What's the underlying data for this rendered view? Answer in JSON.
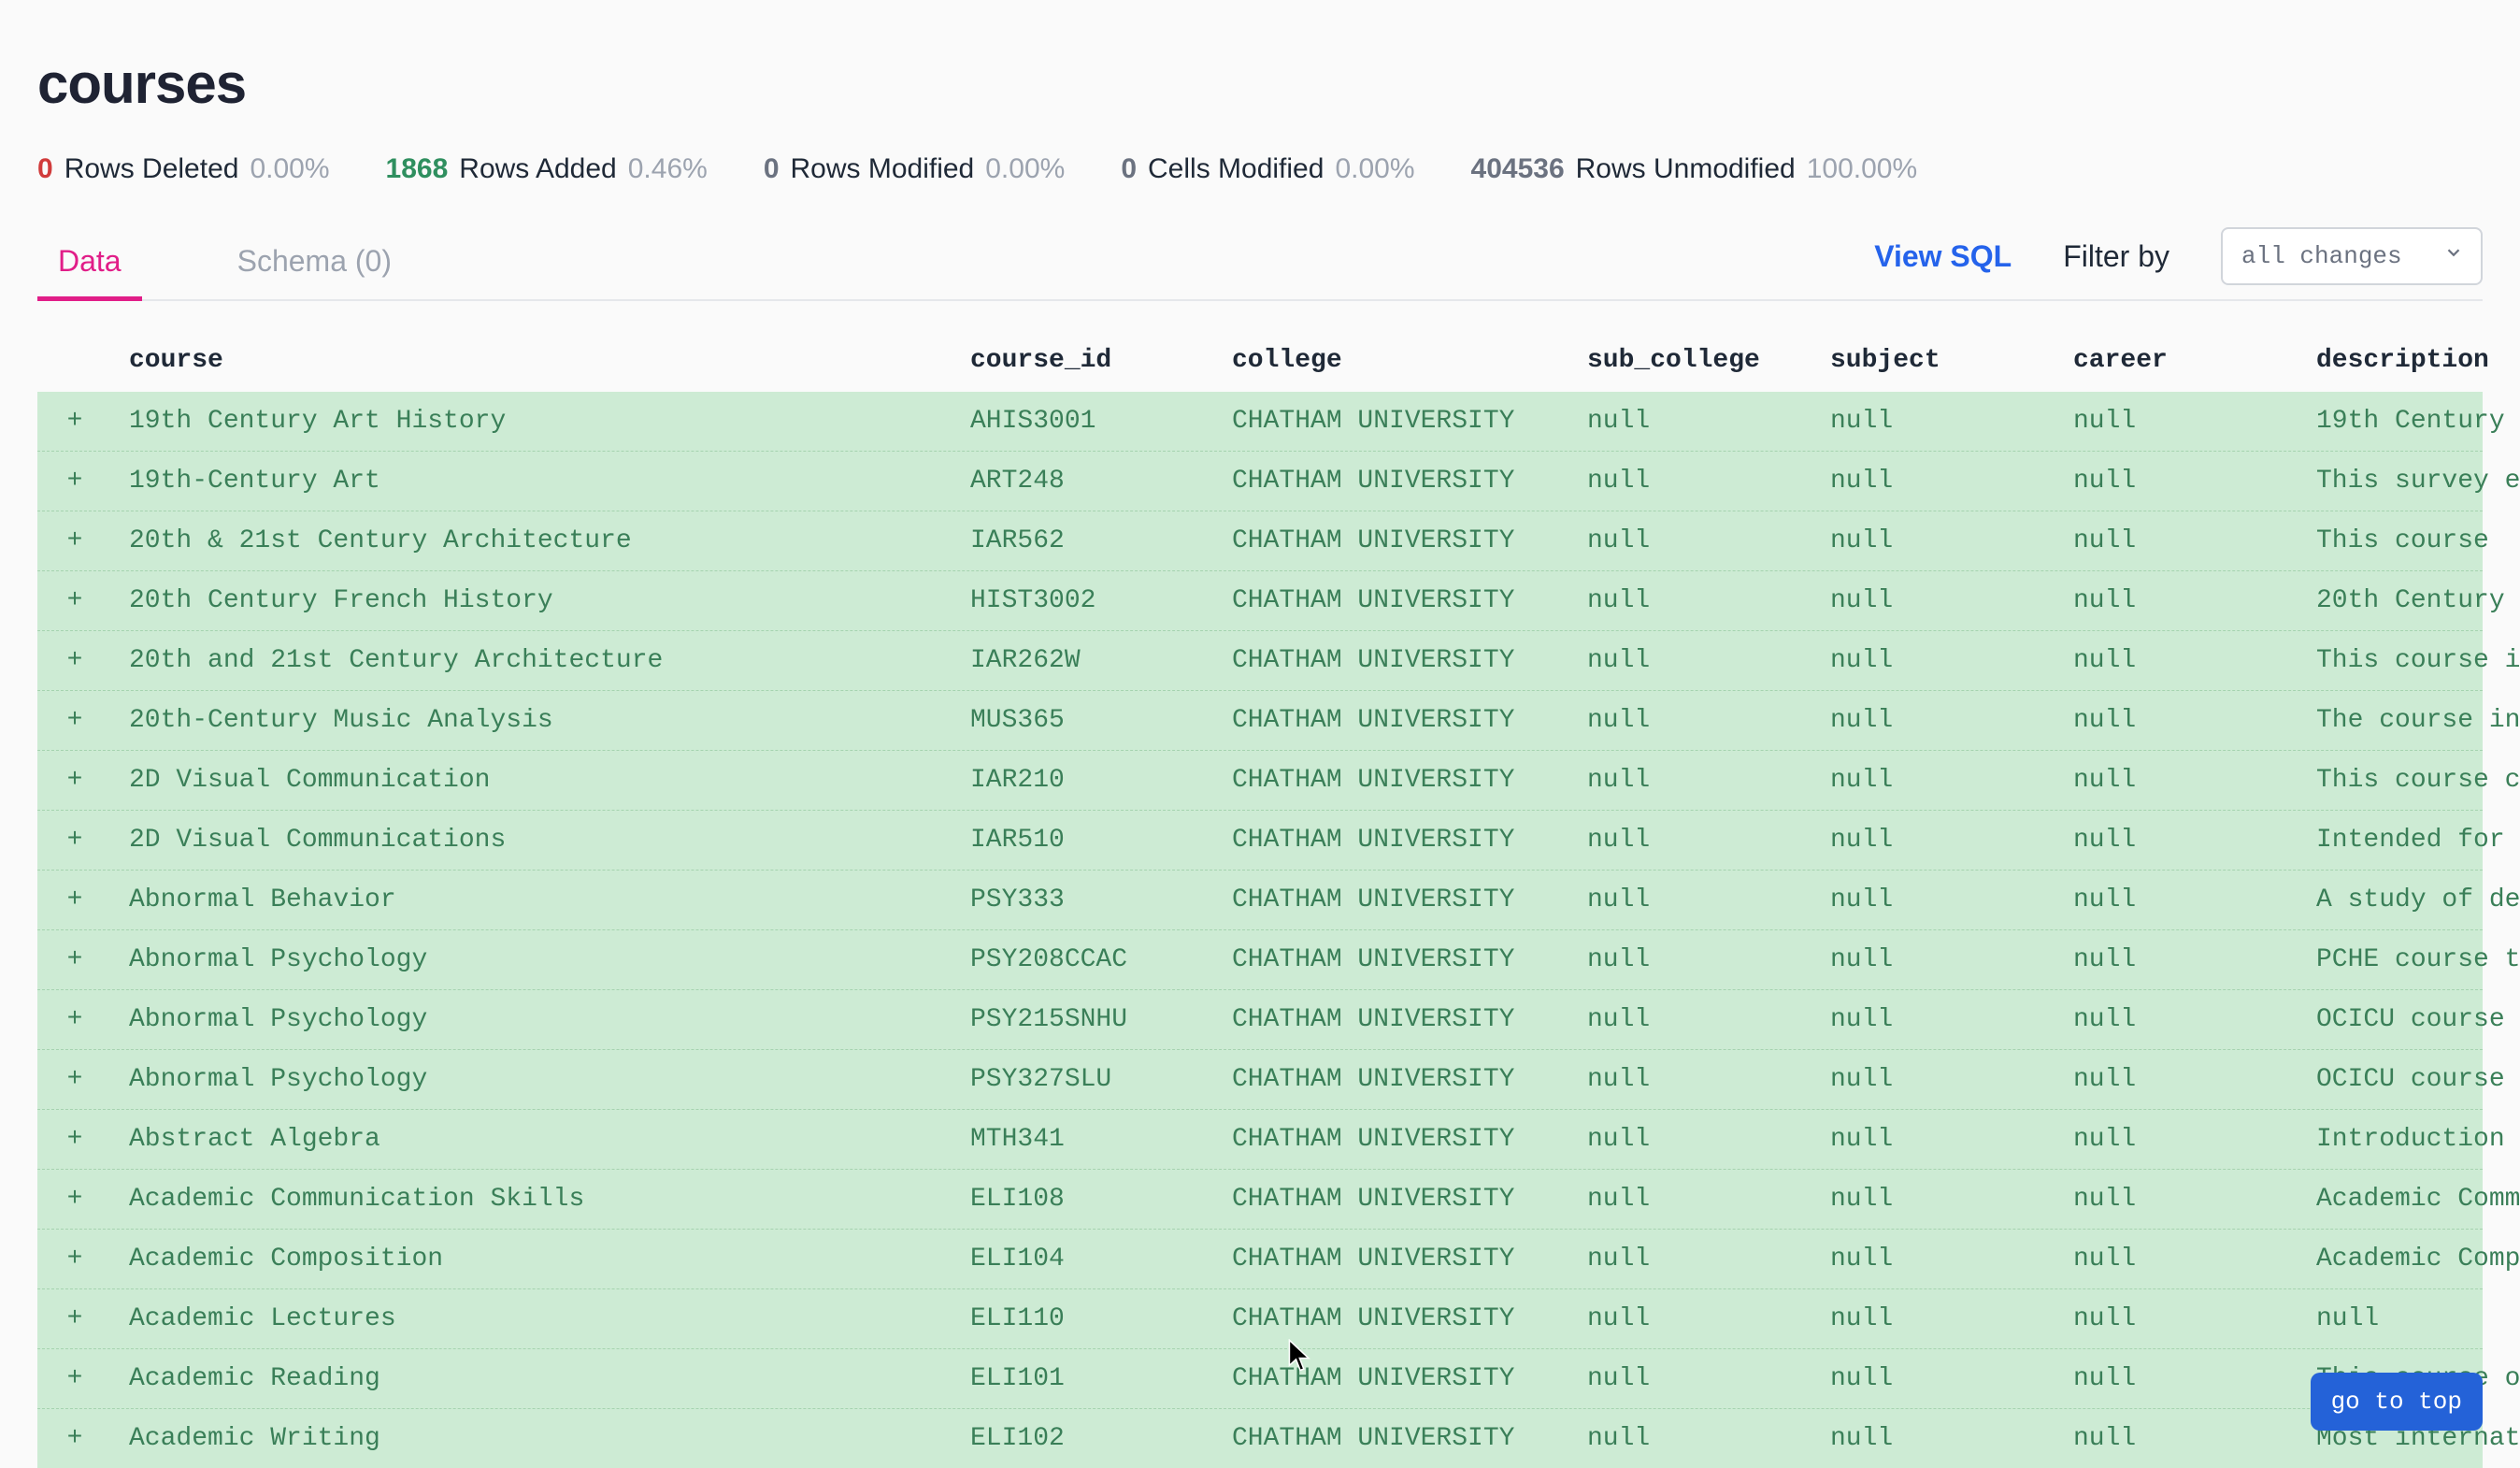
{
  "title": "courses",
  "stats": {
    "deleted": {
      "count": "0",
      "label": "Rows Deleted",
      "pct": "0.00%"
    },
    "added": {
      "count": "1868",
      "label": "Rows Added",
      "pct": "0.46%"
    },
    "modified": {
      "count": "0",
      "label": "Rows Modified",
      "pct": "0.00%"
    },
    "cells": {
      "count": "0",
      "label": "Cells Modified",
      "pct": "0.00%"
    },
    "unmodified": {
      "count": "404536",
      "label": "Rows Unmodified",
      "pct": "100.00%"
    }
  },
  "tabs": {
    "data": "Data",
    "schema": "Schema (0)"
  },
  "controls": {
    "view_sql": "View SQL",
    "filter_label": "Filter by",
    "filter_value": "all changes"
  },
  "columns": {
    "course": "course",
    "course_id": "course_id",
    "college": "college",
    "sub_college": "sub_college",
    "subject": "subject",
    "career": "career",
    "description": "description"
  },
  "rows": [
    {
      "marker": "+",
      "course": "19th Century Art History",
      "course_id": "AHIS3001",
      "college": "CHATHAM UNIVERSITY",
      "sub_college": "null",
      "subject": "null",
      "career": "null",
      "description": "19th Century"
    },
    {
      "marker": "+",
      "course": "19th-Century Art",
      "course_id": "ART248",
      "college": "CHATHAM UNIVERSITY",
      "sub_college": "null",
      "subject": "null",
      "career": "null",
      "description": "This survey e"
    },
    {
      "marker": "+",
      "course": "20th & 21st Century Architecture",
      "course_id": "IAR562",
      "college": "CHATHAM UNIVERSITY",
      "sub_college": "null",
      "subject": "null",
      "career": "null",
      "description": "This course"
    },
    {
      "marker": "+",
      "course": "20th Century French History",
      "course_id": "HIST3002",
      "college": "CHATHAM UNIVERSITY",
      "sub_college": "null",
      "subject": "null",
      "career": "null",
      "description": "20th Century"
    },
    {
      "marker": "+",
      "course": "20th and 21st Century Architecture",
      "course_id": "IAR262W",
      "college": "CHATHAM UNIVERSITY",
      "sub_college": "null",
      "subject": "null",
      "career": "null",
      "description": "This course i"
    },
    {
      "marker": "+",
      "course": "20th-Century Music Analysis",
      "course_id": "MUS365",
      "college": "CHATHAM UNIVERSITY",
      "sub_college": "null",
      "subject": "null",
      "career": "null",
      "description": "The course in"
    },
    {
      "marker": "+",
      "course": "2D Visual Communication",
      "course_id": "IAR210",
      "college": "CHATHAM UNIVERSITY",
      "sub_college": "null",
      "subject": "null",
      "career": "null",
      "description": "This course c"
    },
    {
      "marker": "+",
      "course": "2D Visual Communications",
      "course_id": "IAR510",
      "college": "CHATHAM UNIVERSITY",
      "sub_college": "null",
      "subject": "null",
      "career": "null",
      "description": "Intended for"
    },
    {
      "marker": "+",
      "course": "Abnormal Behavior",
      "course_id": "PSY333",
      "college": "CHATHAM UNIVERSITY",
      "sub_college": "null",
      "subject": "null",
      "career": "null",
      "description": "A study of de"
    },
    {
      "marker": "+",
      "course": "Abnormal Psychology",
      "course_id": "PSY208CCAC",
      "college": "CHATHAM UNIVERSITY",
      "sub_college": "null",
      "subject": "null",
      "career": "null",
      "description": "PCHE course t"
    },
    {
      "marker": "+",
      "course": "Abnormal Psychology",
      "course_id": "PSY215SNHU",
      "college": "CHATHAM UNIVERSITY",
      "sub_college": "null",
      "subject": "null",
      "career": "null",
      "description": "OCICU course"
    },
    {
      "marker": "+",
      "course": "Abnormal Psychology",
      "course_id": "PSY327SLU",
      "college": "CHATHAM UNIVERSITY",
      "sub_college": "null",
      "subject": "null",
      "career": "null",
      "description": "OCICU course"
    },
    {
      "marker": "+",
      "course": "Abstract Algebra",
      "course_id": "MTH341",
      "college": "CHATHAM UNIVERSITY",
      "sub_college": "null",
      "subject": "null",
      "career": "null",
      "description": "Introduction"
    },
    {
      "marker": "+",
      "course": "Academic Communication Skills",
      "course_id": "ELI108",
      "college": "CHATHAM UNIVERSITY",
      "sub_college": "null",
      "subject": "null",
      "career": "null",
      "description": "Academic Comm"
    },
    {
      "marker": "+",
      "course": "Academic Composition",
      "course_id": "ELI104",
      "college": "CHATHAM UNIVERSITY",
      "sub_college": "null",
      "subject": "null",
      "career": "null",
      "description": "Academic Comp"
    },
    {
      "marker": "+",
      "course": "Academic Lectures",
      "course_id": "ELI110",
      "college": "CHATHAM UNIVERSITY",
      "sub_college": "null",
      "subject": "null",
      "career": "null",
      "description": "null"
    },
    {
      "marker": "+",
      "course": "Academic Reading",
      "course_id": "ELI101",
      "college": "CHATHAM UNIVERSITY",
      "sub_college": "null",
      "subject": "null",
      "career": "null",
      "description": "This course o"
    },
    {
      "marker": "+",
      "course": "Academic Writing",
      "course_id": "ELI102",
      "college": "CHATHAM UNIVERSITY",
      "sub_college": "null",
      "subject": "null",
      "career": "null",
      "description": "Most internat"
    }
  ],
  "go_to_top": "go to top"
}
